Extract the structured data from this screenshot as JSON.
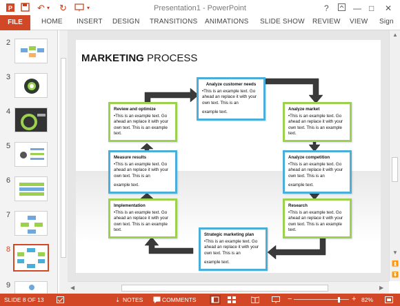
{
  "window": {
    "title": "Presentation1 - PowerPoint",
    "controls": {
      "help": "?",
      "minimize": "—",
      "maximize": "□",
      "close": "✕"
    }
  },
  "ribbon": {
    "file_label": "FILE",
    "tabs": [
      "HOME",
      "INSERT",
      "DESIGN",
      "TRANSITIONS",
      "ANIMATIONS",
      "SLIDE SHOW",
      "REVIEW",
      "VIEW",
      "Sign"
    ]
  },
  "thumbnails": {
    "numbers": [
      "2",
      "3",
      "4",
      "5",
      "6",
      "7",
      "8",
      "9"
    ],
    "selected": "8"
  },
  "slide": {
    "title_bold": "MARKETING",
    "title_rest": " PROCESS",
    "boxes": {
      "analyze_customer": {
        "heading": "Analyze customer needs",
        "body": "•This is an example text. Go ahead an replace it with your own text. This is an",
        "tail": "example text."
      },
      "analyze_market": {
        "heading": "Analyze market",
        "body": "•This is an example text. Go ahead an replace it with your own text. This is an example text."
      },
      "analyze_competition": {
        "heading": "Analyze competition",
        "body": "•This is an example text. Go ahead an replace it with your own text. This is an",
        "tail": "example text."
      },
      "research": {
        "heading": "Research",
        "body": "•This is an example text. Go ahead an replace it with your own text. This is an example text."
      },
      "strategic_plan": {
        "heading": "Strategic marketing plan",
        "body": "•This is an example text. Go ahead an replace it with your own text. This is an",
        "tail": "example text."
      },
      "implementation": {
        "heading": "Implementation",
        "body": "•This is an example text. Go ahead an replace it with your own text. This is an example text."
      },
      "measure_results": {
        "heading": "Measure results",
        "body": "•This is an example text. Go ahead an replace it with your own text. This is an",
        "tail": "example text."
      },
      "review_optimize": {
        "heading": "Review and optimize",
        "body": "•This is an example text. Go ahead an replace it with your own text. This is an example text."
      }
    }
  },
  "status": {
    "slide_indicator": "SLIDE 8 OF 13",
    "notes": "NOTES",
    "comments": "COMMENTS",
    "zoom": "82%",
    "minus": "−",
    "plus": "+"
  },
  "colors": {
    "accent": "#d24726",
    "green_border": "#9bd14f",
    "blue_border": "#4aaed9",
    "arrow": "#3a3a3a"
  }
}
